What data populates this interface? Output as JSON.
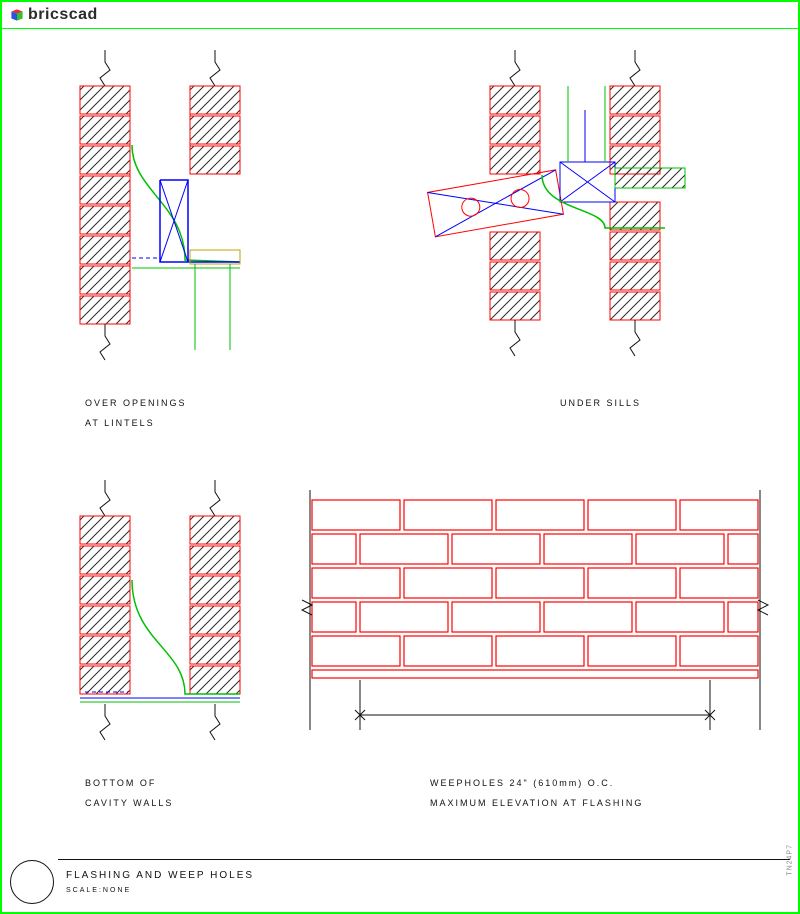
{
  "brand": "bricscad",
  "labels": {
    "detail1_line1": "OVER OPENINGS",
    "detail1_line2": "AT LINTELS",
    "detail2_line1": "UNDER SILLS",
    "detail3_line1": "BOTTOM OF",
    "detail3_line2": "CAVITY WALLS",
    "detail4_line1": "WEEPHOLES 24\" (610mm) O.C.",
    "detail4_line2": "MAXIMUM ELEVATION AT FLASHING"
  },
  "title": {
    "main": "FLASHING AND WEEP HOLES",
    "scale": "SCALE:NONE"
  },
  "sidecode": "TN24P7",
  "colors": {
    "brick": "#ff0000",
    "flashing": "#00c000",
    "steel": "#0000ff",
    "hatch": "#2b2b2b",
    "frame": "#00ff00"
  }
}
